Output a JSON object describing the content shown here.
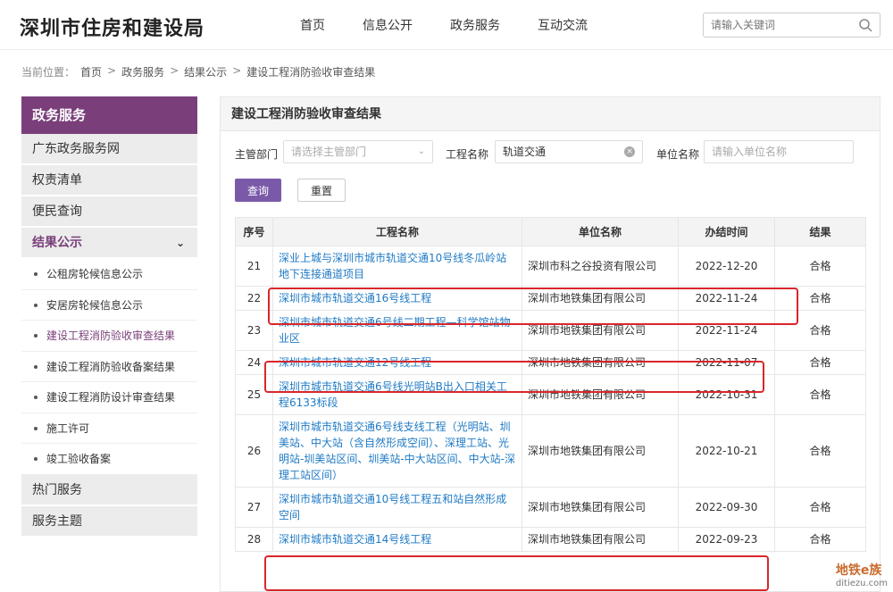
{
  "header": {
    "logo": "深圳市住房和建设局",
    "nav": [
      "首页",
      "信息公开",
      "政务服务",
      "互动交流"
    ],
    "search_placeholder": "请输入关键词"
  },
  "breadcrumb": {
    "prefix": "当前位置：",
    "items": [
      "首页",
      "政务服务",
      "结果公示",
      "建设工程消防验收审查结果"
    ]
  },
  "sidebar": {
    "title": "政务服务",
    "items": [
      "广东政务服务网",
      "权责清单",
      "便民查询",
      "结果公示"
    ],
    "sub_items": [
      "公租房轮候信息公示",
      "安居房轮候信息公示",
      "建设工程消防验收审查结果",
      "建设工程消防验收备案结果",
      "建设工程消防设计审查结果",
      "施工许可",
      "竣工验收备案"
    ],
    "bottom_items": [
      "热门服务",
      "服务主题"
    ]
  },
  "panel": {
    "title": "建设工程消防验收审查结果",
    "filter": {
      "dept_label": "主管部门",
      "dept_placeholder": "请选择主管部门",
      "project_label": "工程名称",
      "project_value": "轨道交通",
      "unit_label": "单位名称",
      "unit_placeholder": "请输入单位名称"
    },
    "query_button": "查询",
    "reset_button": "重置"
  },
  "table": {
    "headers": [
      "序号",
      "工程名称",
      "单位名称",
      "办结时间",
      "结果"
    ],
    "rows": [
      {
        "no": "21",
        "name": "深业上城与深圳市城市轨道交通10号线冬瓜岭站地下连接通道项目",
        "unit": "深圳市科之谷投资有限公司",
        "date": "2022-12-20",
        "result": "合格"
      },
      {
        "no": "22",
        "name": "深圳市城市轨道交通16号线工程",
        "unit": "深圳市地铁集团有限公司",
        "date": "2022-11-24",
        "result": "合格"
      },
      {
        "no": "23",
        "name": "深圳市城市轨道交通6号线二期工程—科学馆站物业区",
        "unit": "深圳市地铁集团有限公司",
        "date": "2022-11-24",
        "result": "合格"
      },
      {
        "no": "24",
        "name": "深圳市城市轨道交通12号线工程",
        "unit": "深圳市地铁集团有限公司",
        "date": "2022-11-07",
        "result": "合格"
      },
      {
        "no": "25",
        "name": "深圳市城市轨道交通6号线光明站B出入口相关工程6133标段",
        "unit": "深圳市地铁集团有限公司",
        "date": "2022-10-31",
        "result": "合格"
      },
      {
        "no": "26",
        "name": "深圳市城市轨道交通6号线支线工程（光明站、圳美站、中大站（含自然形成空间）、深理工站、光明站-圳美站区间、圳美站-中大站区间、中大站-深理工站区间）",
        "unit": "深圳市地铁集团有限公司",
        "date": "2022-10-21",
        "result": "合格"
      },
      {
        "no": "27",
        "name": "深圳市城市轨道交通10号线工程五和站自然形成空间",
        "unit": "深圳市地铁集团有限公司",
        "date": "2022-09-30",
        "result": "合格"
      },
      {
        "no": "28",
        "name": "深圳市城市轨道交通14号线工程",
        "unit": "深圳市地铁集团有限公司",
        "date": "2022-09-23",
        "result": "合格"
      }
    ]
  },
  "watermark": {
    "text": "地铁e族",
    "sub": "ditiezu.com"
  },
  "colors": {
    "brand": "#7a3f7a",
    "link": "#1f7ac4",
    "highlight": "#d9262b",
    "button": "#7a5aa8"
  }
}
